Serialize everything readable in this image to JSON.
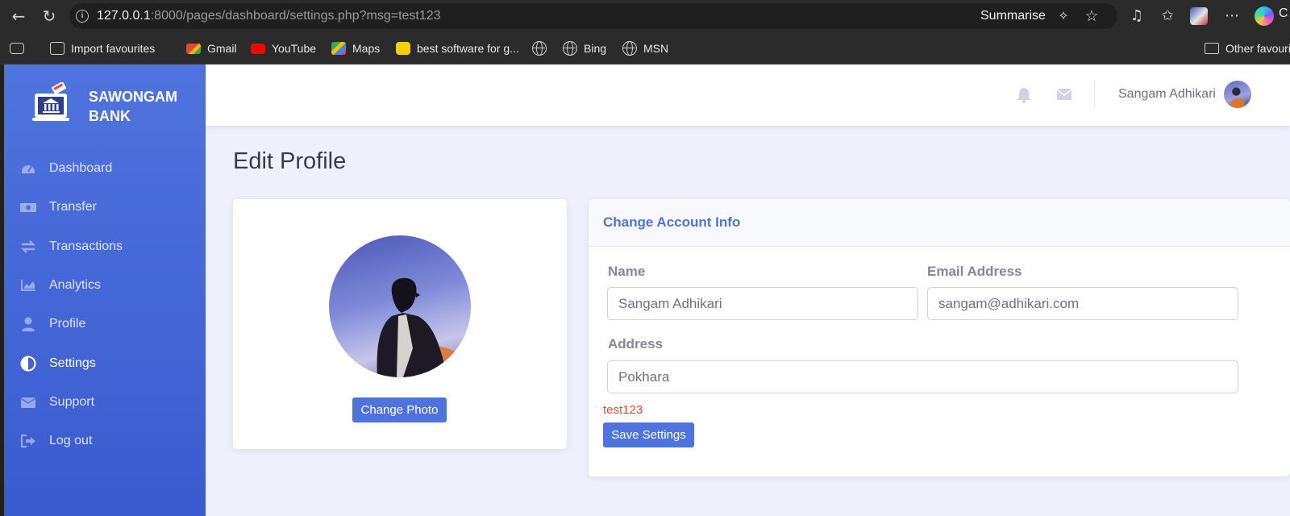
{
  "browser": {
    "url_host": "127.0.0.1",
    "url_rest": ":8000/pages/dashboard/settings.php?msg=test123",
    "summarise_label": "Summarise",
    "copilot_letter": "C",
    "bookmarks": [
      {
        "label": "Import favourites",
        "icon": "import-icon"
      },
      {
        "label": "Gmail",
        "icon": "gmail-icon"
      },
      {
        "label": "YouTube",
        "icon": "youtube-icon"
      },
      {
        "label": "Maps",
        "icon": "maps-icon"
      },
      {
        "label": "best software for g...",
        "icon": "site-icon"
      },
      {
        "label": "",
        "icon": "globe-icon"
      },
      {
        "label": "Bing",
        "icon": "globe-icon"
      },
      {
        "label": "MSN",
        "icon": "globe-icon"
      }
    ],
    "other_favourites_label": "Other favourites"
  },
  "sidebar": {
    "brand_line1": "SAWONGAM",
    "brand_line2": "BANK",
    "items": [
      {
        "label": "Dashboard",
        "icon": "speedometer-icon",
        "active": false
      },
      {
        "label": "Transfer",
        "icon": "money-bill-icon",
        "active": false
      },
      {
        "label": "Transactions",
        "icon": "exchange-icon",
        "active": false
      },
      {
        "label": "Analytics",
        "icon": "area-chart-icon",
        "active": false
      },
      {
        "label": "Profile",
        "icon": "user-icon",
        "active": false
      },
      {
        "label": "Settings",
        "icon": "adjust-icon",
        "active": true
      },
      {
        "label": "Support",
        "icon": "envelope-icon",
        "active": false
      },
      {
        "label": "Log out",
        "icon": "sign-out-icon",
        "active": false
      }
    ]
  },
  "topbar": {
    "user_name": "Sangam Adhikari"
  },
  "main": {
    "page_title": "Edit Profile",
    "change_photo_label": "Change Photo",
    "account_card": {
      "title": "Change Account Info",
      "name_label": "Name",
      "name_value": "Sangam Adhikari",
      "email_label": "Email Address",
      "email_value": "sangam@adhikari.com",
      "address_label": "Address",
      "address_value": "Pokhara",
      "message": "test123",
      "save_label": "Save Settings"
    }
  },
  "colors": {
    "primary": "#4e73df",
    "sidebar_top": "#4f73de",
    "sidebar_bottom": "#3a5bd0",
    "error": "#e74a3b",
    "page_bg": "#eef0fb"
  }
}
